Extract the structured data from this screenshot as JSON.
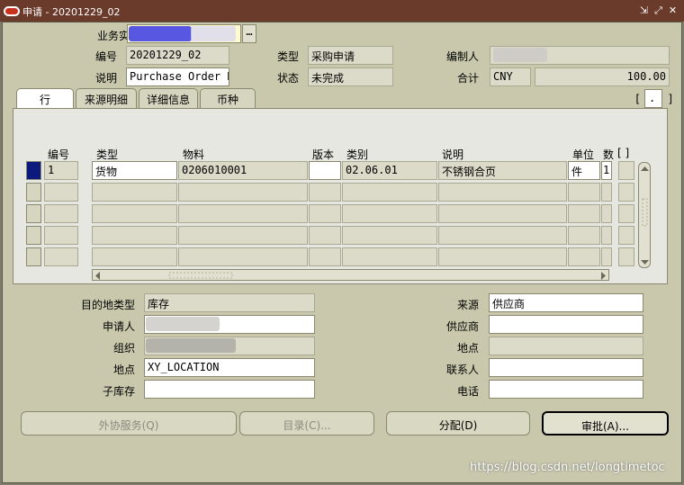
{
  "window": {
    "title": "申请 - 20201229_02",
    "controls": [
      "⇲",
      "⤢",
      "✕"
    ]
  },
  "header": {
    "business_entity_label": "业务实体",
    "business_entity_lov": "…",
    "number_label": "编号",
    "number_value": "20201229_02",
    "type_label": "类型",
    "type_value": "采购申请",
    "preparer_label": "编制人",
    "description_label": "说明",
    "description_value": "Purchase Order R",
    "status_label": "状态",
    "status_value": "未完成",
    "total_label": "合计",
    "currency_value": "CNY",
    "total_value": "100.00",
    "bracket_left": "[",
    "bracket_dot": ".",
    "bracket_right": "]"
  },
  "tabs": [
    {
      "label": "行",
      "active": true
    },
    {
      "label": "来源明细",
      "active": false
    },
    {
      "label": "详细信息",
      "active": false
    },
    {
      "label": "币种",
      "active": false
    }
  ],
  "lines": {
    "columns": [
      "编号",
      "类型",
      "物料",
      "版本",
      "类别",
      "说明",
      "单位",
      "数",
      "[ ]"
    ],
    "rows": [
      {
        "num": "1",
        "type": "货物",
        "item": "0206010001",
        "rev": "",
        "category": "02.06.01",
        "desc": "不锈钢合页",
        "uom": "件",
        "qty": "1"
      },
      {
        "num": "",
        "type": "",
        "item": "",
        "rev": "",
        "category": "",
        "desc": "",
        "uom": "",
        "qty": ""
      },
      {
        "num": "",
        "type": "",
        "item": "",
        "rev": "",
        "category": "",
        "desc": "",
        "uom": "",
        "qty": ""
      },
      {
        "num": "",
        "type": "",
        "item": "",
        "rev": "",
        "category": "",
        "desc": "",
        "uom": "",
        "qty": ""
      },
      {
        "num": "",
        "type": "",
        "item": "",
        "rev": "",
        "category": "",
        "desc": "",
        "uom": "",
        "qty": ""
      }
    ]
  },
  "details": {
    "dest_type_label": "目的地类型",
    "dest_type_value": "库存",
    "requester_label": "申请人",
    "org_label": "组织",
    "location_label": "地点",
    "location_value": "XY_LOCATION",
    "subinventory_label": "子库存",
    "subinventory_value": "",
    "source_label": "来源",
    "source_value": "供应商",
    "supplier_label": "供应商",
    "supplier_value": "",
    "site_label": "地点",
    "site_value": "",
    "contact_label": "联系人",
    "contact_value": "",
    "phone_label": "电话",
    "phone_value": ""
  },
  "buttons": {
    "outside_services": "外协服务(Q)",
    "catalog": "目录(C)...",
    "distributions": "分配(D)",
    "approve": "审批(A)..."
  },
  "watermark": "https://blog.csdn.net/longtimetoc"
}
